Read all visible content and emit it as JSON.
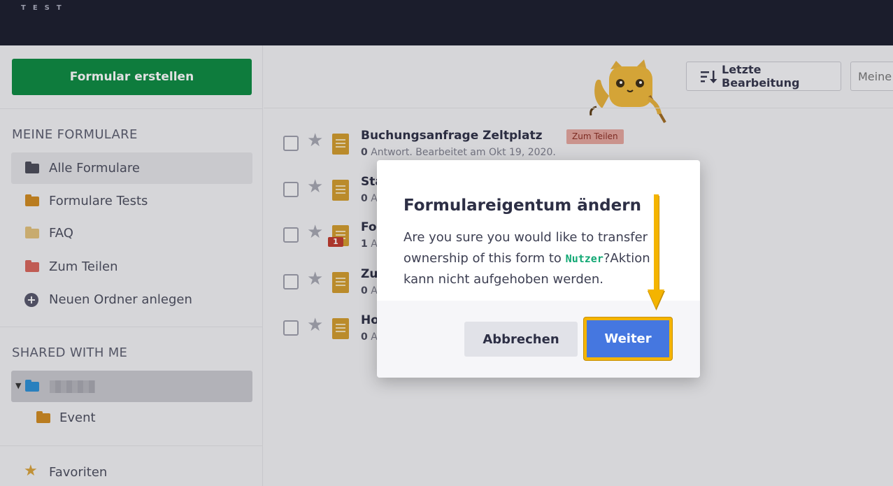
{
  "topbar": {
    "logo_text": "TEST"
  },
  "sidebar": {
    "create_button": "Formular erstellen",
    "my_forms_title": "MEINE FORMULARE",
    "my_forms": [
      {
        "label": "Alle Formulare",
        "color": "#4a4b58"
      },
      {
        "label": "Formulare Tests",
        "color": "#d18a1e"
      },
      {
        "label": "FAQ",
        "color": "#e2c17a"
      },
      {
        "label": "Zum Teilen",
        "color": "#d9655a"
      }
    ],
    "new_folder_label": "Neuen Ordner anlegen",
    "shared_title": "SHARED WITH ME",
    "shared_subfolder": "Event",
    "favorites_label": "Favoriten",
    "favorites_color": "#d9a23a"
  },
  "toolbar": {
    "sort_label": "Letzte Bearbeitung",
    "search_placeholder": "Meine"
  },
  "forms": [
    {
      "title": "Buchungsanfrage Zeltplatz",
      "tag": "Zum Teilen",
      "count": "0",
      "meta": " Antwort. Bearbeitet am Okt 19, 2020."
    },
    {
      "title": "Sta",
      "count": "0",
      "meta": " A"
    },
    {
      "title": "Fo",
      "count": "1",
      "meta": " A",
      "badge": "1"
    },
    {
      "title": "Zu",
      "count": "0",
      "meta": " A"
    },
    {
      "title": "Ho",
      "count": "0",
      "meta": " A"
    }
  ],
  "modal": {
    "title": "Formulareigentum ändern",
    "body_before": "Are you sure you would like to transfer ownership of this form to ",
    "user": "Nutzer",
    "body_after": "?Aktion kann nicht aufgehoben werden.",
    "cancel_label": "Abbrechen",
    "confirm_label": "Weiter"
  },
  "colors": {
    "accent_green": "#0a8a3f",
    "confirm_blue": "#4577e0",
    "highlight_yellow": "#f4b400"
  }
}
